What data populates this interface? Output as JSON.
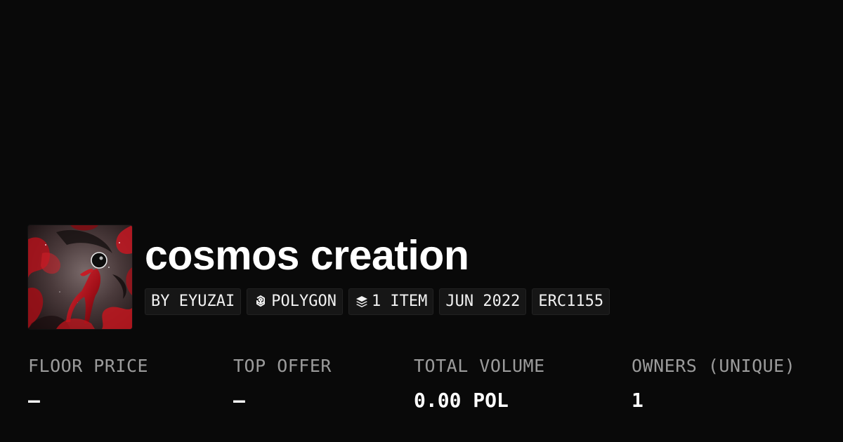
{
  "collection": {
    "title": "cosmos creation",
    "avatar_icon": "collection-artwork-image"
  },
  "badges": {
    "creator": "BY EYUZAI",
    "chain": "POLYGON",
    "chain_icon": "polygon-chain-icon",
    "items": "1 ITEM",
    "items_icon": "layers-icon",
    "date": "JUN 2022",
    "standard": "ERC1155"
  },
  "stats": {
    "floor_price": {
      "label": "FLOOR PRICE",
      "value": "–"
    },
    "top_offer": {
      "label": "TOP OFFER",
      "value": "–"
    },
    "total_volume": {
      "label": "TOTAL VOLUME",
      "value": "0.00 POL"
    },
    "owners": {
      "label": "OWNERS (UNIQUE)",
      "value": "1"
    }
  },
  "colors": {
    "background": "#090909",
    "badge_background": "#161616",
    "label_gray": "#9b9b9b",
    "text_white": "#ffffff",
    "artwork_red": "#c4121c"
  }
}
